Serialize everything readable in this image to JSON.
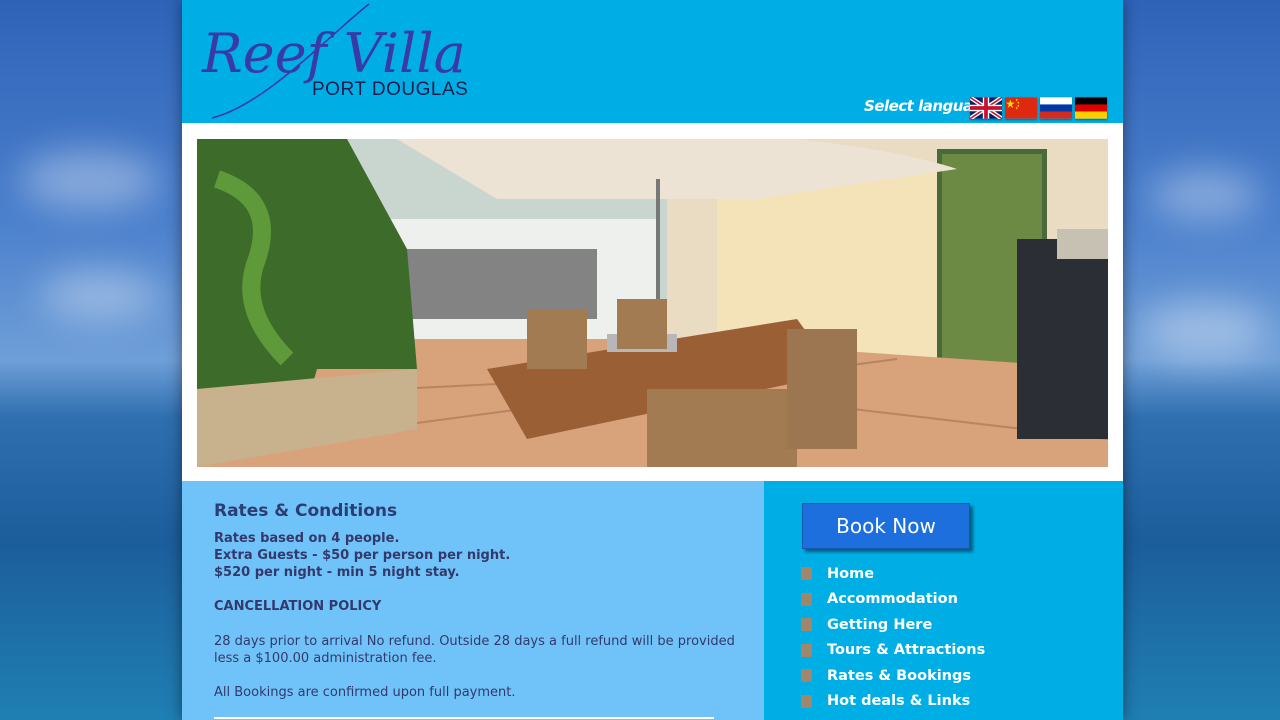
{
  "logo": {
    "script": "Reef Villa",
    "subtitle": "PORT DOUGLAS"
  },
  "language": {
    "label": "Select language :",
    "flags": [
      "uk-flag-icon",
      "china-flag-icon",
      "russia-flag-icon",
      "germany-flag-icon"
    ]
  },
  "hero": {
    "image": "villa-patio-dining-photo"
  },
  "rates": {
    "title": "Rates & Conditions",
    "line1": "Rates based on 4 people.",
    "line2": "Extra Guests - $50 per person per night.",
    "line3": "$520 per night - min 5 night stay.",
    "cancel_heading": "CANCELLATION POLICY",
    "cancel_line1": "28 days prior to arrival No refund. Outside 28 days a full refund will be provided",
    "cancel_line2": "less a $100.00 administration fee.",
    "confirm": "All Bookings are confirmed upon full payment."
  },
  "sidebar": {
    "book_label": "Book Now",
    "nav": [
      "Home",
      "Accommodation",
      "Getting Here",
      "Tours & Attractions",
      "Rates & Bookings",
      "Hot deals & Links"
    ]
  },
  "colors": {
    "header": "#00aee6",
    "content_bg": "#70c3f9",
    "sidebar_bg": "#00aee6",
    "book_button": "#1c6fdc",
    "logo_text": "#3a3aa6",
    "bullet": "#a0866a"
  }
}
